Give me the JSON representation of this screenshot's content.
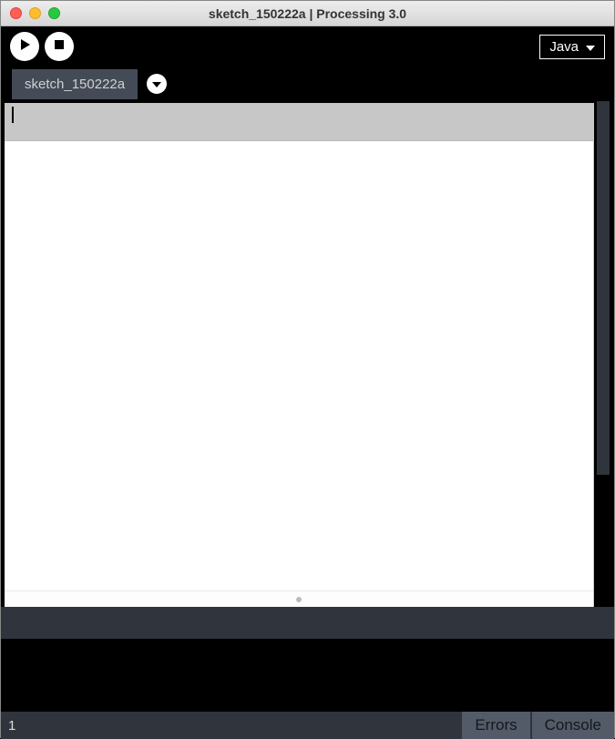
{
  "window": {
    "title": "sketch_150222a | Processing 3.0"
  },
  "toolbar": {
    "mode_label": "Java"
  },
  "tabs": {
    "items": [
      {
        "label": "sketch_150222a"
      }
    ]
  },
  "footer": {
    "line_number": "1",
    "errors_label": "Errors",
    "console_label": "Console"
  }
}
